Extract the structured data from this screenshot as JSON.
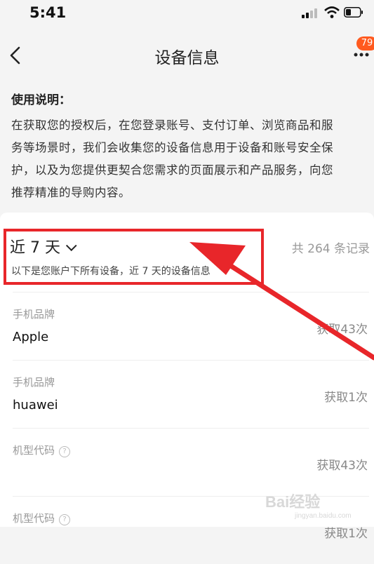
{
  "status_bar": {
    "time": "5:41"
  },
  "nav": {
    "title": "设备信息",
    "badge": "79"
  },
  "intro": {
    "title": "使用说明：",
    "lines": [
      "在获取您的授权后，在您登录账号、支付订单、浏览商品和服",
      "务等场景时，我们会收集您的设备信息用于设备和账号安全保",
      "护，以及为您提供更契合您需求的页面展示和产品服务，向您",
      "推荐精准的导购内容。"
    ]
  },
  "filter": {
    "range_label": "近 7 天",
    "record_count": "共 264 条记录",
    "description": "以下是您账户下所有设备，近 7 天的设备信息"
  },
  "records": [
    {
      "label": "手机品牌",
      "value": "Apple",
      "count": "获取43次"
    },
    {
      "label": "手机品牌",
      "value": "huawei",
      "count": "获取1次"
    },
    {
      "label": "机型代码",
      "value": "",
      "count": "获取43次"
    },
    {
      "label": "机型代码",
      "value": "",
      "count": "获取1次"
    }
  ],
  "watermark": {
    "main": "Bai经验",
    "sub": "jingyan.baidu.com"
  },
  "colors": {
    "highlight": "#e8262a",
    "badge": "#ff5a1f"
  }
}
